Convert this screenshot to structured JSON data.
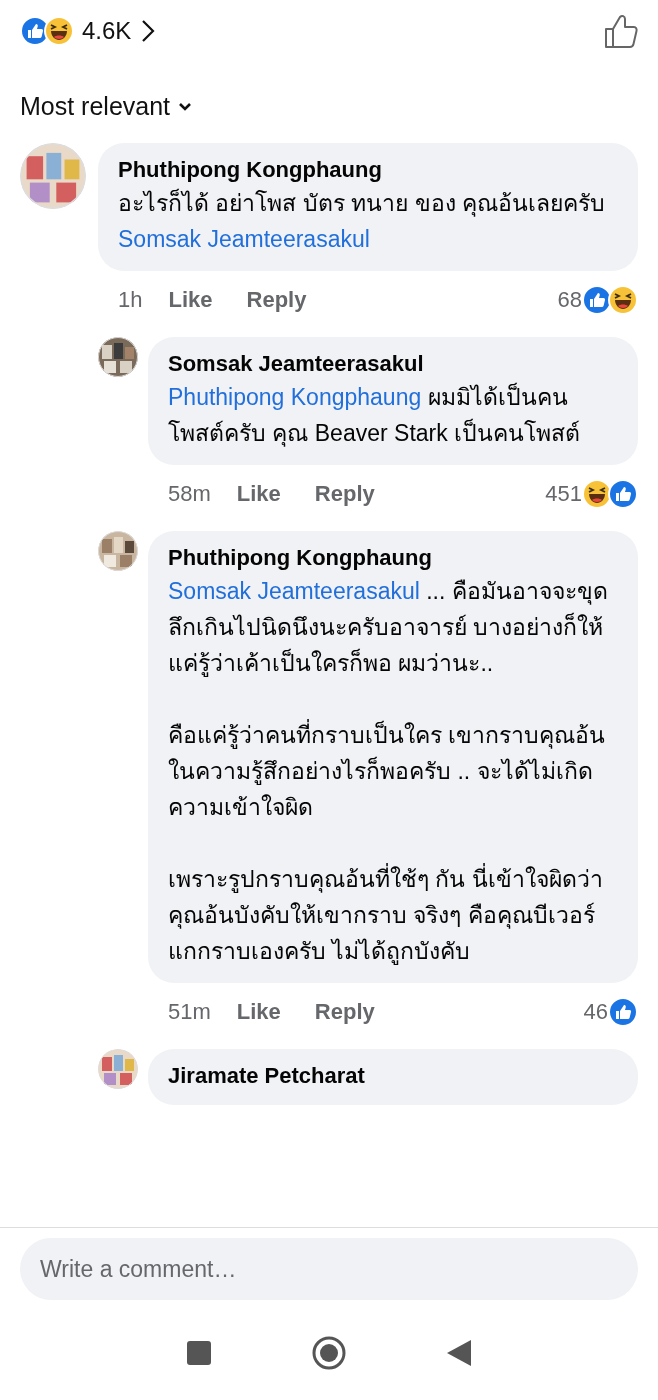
{
  "summary": {
    "reactions": [
      {
        "kind": "like"
      },
      {
        "kind": "haha"
      }
    ],
    "count": "4.6K"
  },
  "sort": {
    "label": "Most relevant"
  },
  "comments": [
    {
      "kind": "comment",
      "author": "Phuthipong Kongphaung",
      "paragraphs": [
        [
          {
            "kind": "text",
            "text": "อะไรก็ได้ อย่าโพส บัตร ทนาย ของ คุณอ้นเลยครับ"
          },
          {
            "kind": "mention",
            "text": "Somsak Jeamteerasakul"
          }
        ]
      ],
      "time": "1h",
      "actions": [
        "Like",
        "Reply"
      ],
      "reaction_count": "68",
      "reactions": [
        {
          "kind": "like"
        },
        {
          "kind": "haha"
        }
      ]
    },
    {
      "kind": "reply",
      "author": "Somsak Jeamteerasakul",
      "paragraphs": [
        [
          {
            "kind": "mention",
            "text": "Phuthipong Kongphaung"
          },
          {
            "kind": "text",
            "text": "ผมมิได้เป็นคนโพสต์ครับ คุณ Beaver Stark เป็นคนโพสต์"
          }
        ]
      ],
      "time": "58m",
      "actions": [
        "Like",
        "Reply"
      ],
      "reaction_count": "451",
      "reactions": [
        {
          "kind": "haha"
        },
        {
          "kind": "like"
        }
      ]
    },
    {
      "kind": "reply",
      "author": "Phuthipong Kongphaung",
      "paragraphs": [
        [
          {
            "kind": "mention",
            "text": "Somsak Jeamteerasakul"
          },
          {
            "kind": "text",
            "text": "... คือมันอาจจะขุดลึกเกินไปนิดนึงนะครับอาจารย์ บางอย่างก็ให้แค่รู้ว่าเค้าเป็นใครก็พอ ผมว่านะ.."
          }
        ],
        [
          {
            "kind": "text",
            "text": "คือแค่รู้ว่าคนที่กราบเป็นใคร เขากราบคุณอ้นในความรู้สึกอย่างไรก็พอครับ .. จะได้ไม่เกิดความเข้าใจผิด"
          }
        ],
        [
          {
            "kind": "text",
            "text": "เพราะรูปกราบคุณอ้นที่ใช้ๆ กัน นี่เข้าใจผิดว่าคุณอ้นบังคับให้เขากราบ จริงๆ คือคุณบีเวอร์ แกกราบเองครับ ไม่ได้ถูกบังคับ"
          }
        ]
      ],
      "time": "51m",
      "actions": [
        "Like",
        "Reply"
      ],
      "reaction_count": "46",
      "reactions": [
        {
          "kind": "like"
        }
      ]
    },
    {
      "kind": "reply",
      "author": "Jiramate Petcharat"
    }
  ],
  "composer": {
    "placeholder": "Write a comment…"
  }
}
